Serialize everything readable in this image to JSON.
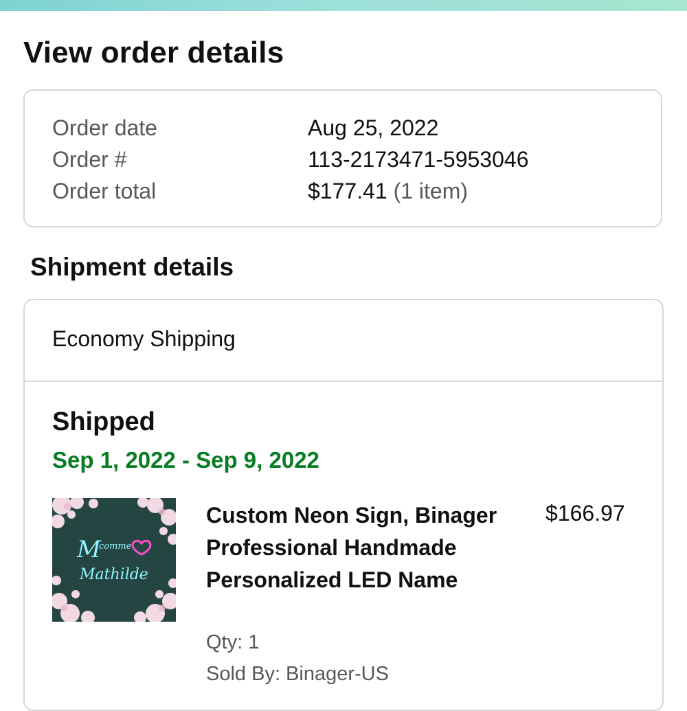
{
  "page": {
    "title": "View order details"
  },
  "summary": {
    "rows": [
      {
        "label": "Order date",
        "value": "Aug 25, 2022"
      },
      {
        "label": "Order #",
        "value": "113-2173471-5953046"
      },
      {
        "label": "Order total",
        "value": "$177.41",
        "note": "(1 item)"
      }
    ]
  },
  "shipment": {
    "section_title": "Shipment details",
    "method": "Economy Shipping",
    "status": "Shipped",
    "date_range": "Sep 1, 2022 - Sep 9, 2022",
    "item": {
      "title": "Custom Neon Sign, Binager Professional Handmade Personalized LED Name",
      "price": "$166.97",
      "qty": "Qty: 1",
      "sold_by": "Sold By: Binager-US",
      "image_text": [
        "M",
        "comme",
        "Mathilde"
      ]
    }
  },
  "colors": {
    "accent_green": "#067d22",
    "top_bar": "#9ee0dc",
    "border": "#d5d9d9",
    "muted_text": "#565959"
  }
}
